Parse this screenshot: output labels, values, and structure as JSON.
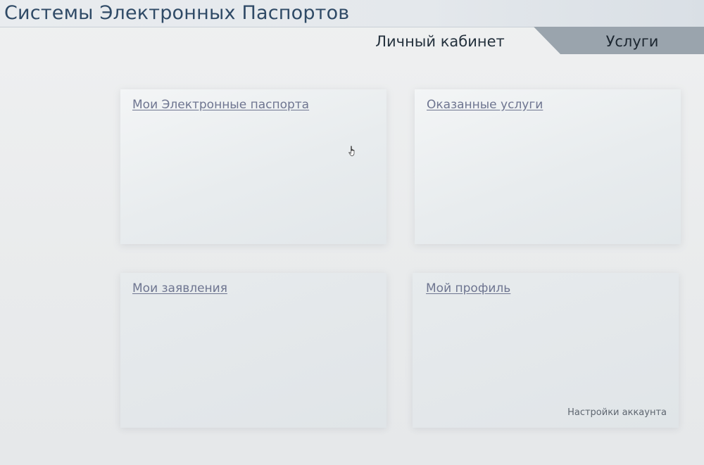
{
  "header": {
    "title": "Системы Электронных Паспортов"
  },
  "nav": {
    "tabs": [
      {
        "label": "Личный кабинет"
      },
      {
        "label": "Услуги"
      }
    ]
  },
  "cards": [
    {
      "title": "Мои Электронные паспорта"
    },
    {
      "title": "Оказанные услуги"
    },
    {
      "title": "Мои заявления"
    },
    {
      "title": "Мой профиль",
      "secondary_link": "Настройки аккаунта"
    }
  ],
  "colors": {
    "title": "#2f4a66",
    "active_tab": "#9aa4ad",
    "link": "#6e7590"
  },
  "icons": {
    "cursor": "hand-pointer-icon"
  }
}
